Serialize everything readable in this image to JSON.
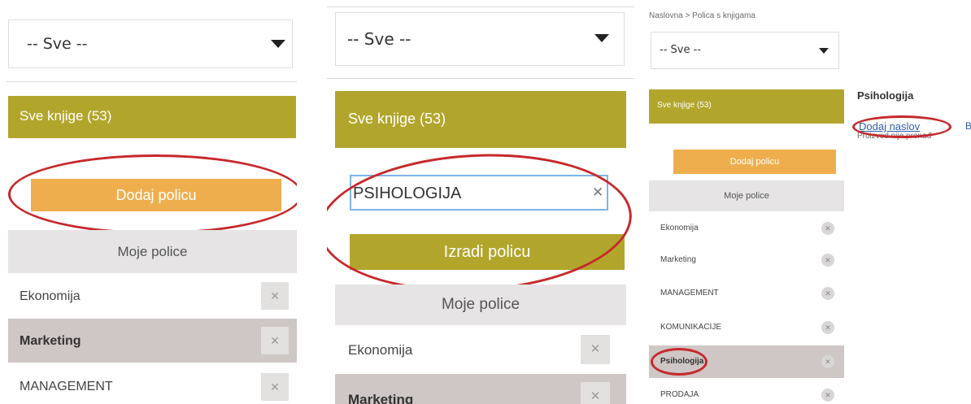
{
  "panel1": {
    "filter_value": "-- Sve --",
    "all_books": "Sve knjige (53)",
    "add_shelf": "Dodaj policu",
    "my_shelves": "Moje police",
    "shelves": [
      "Ekonomija",
      "Marketing",
      "MANAGEMENT"
    ],
    "delete_glyph": "✕"
  },
  "panel2": {
    "filter_value": "-- Sve --",
    "all_books": "Sve knjige (53)",
    "shelf_name_value": "PSIHOLOGIJA",
    "clear_glyph": "✕",
    "create_shelf": "Izradi policu",
    "my_shelves": "Moje police",
    "shelves": [
      "Ekonomija",
      "Marketing"
    ],
    "delete_glyph": "✕"
  },
  "panel3": {
    "breadcrumb": "Naslovna > Polica s knjigama",
    "filter_value": "-- Sve --",
    "all_books": "Sve knjige (53)",
    "add_shelf": "Dodaj policu",
    "my_shelves": "Moje police",
    "shelves": [
      "Ekonomija",
      "Marketing",
      "MANAGEMENT",
      "KOMUNIKACIJE",
      "Psihologija",
      "PRODAJA"
    ],
    "delete_glyph": "✕",
    "shelf_title": "Psihologija",
    "add_title": "Dodaj naslov",
    "cut_link": "B",
    "no_results_partial": "Proizvod nije pronađ"
  },
  "colors": {
    "olive": "#b2a52c",
    "orange": "#efae4e",
    "highlight_ellipse": "#c7282b",
    "selected_row": "#cfc6c6"
  }
}
